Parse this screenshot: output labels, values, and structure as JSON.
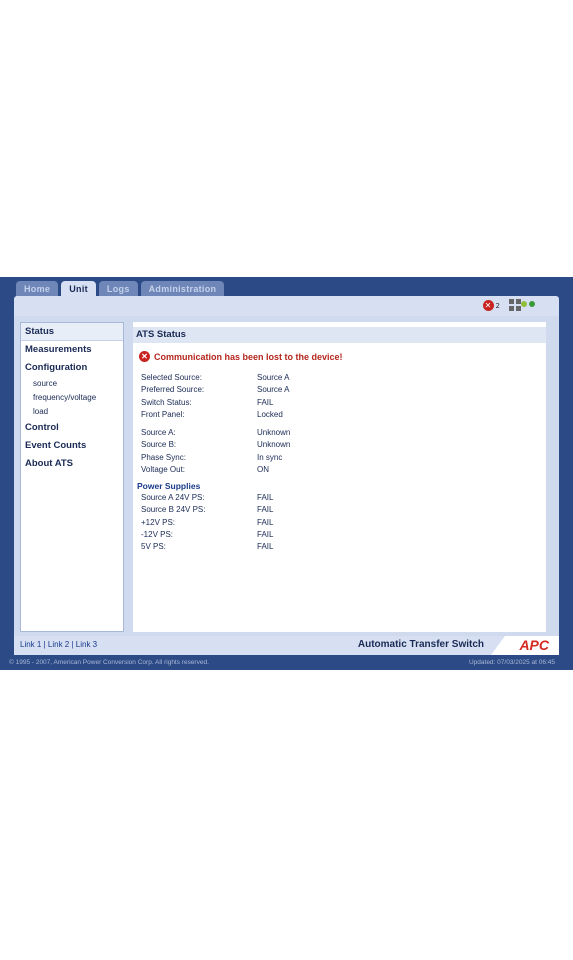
{
  "tabs": [
    "Home",
    "Unit",
    "Logs",
    "Administration"
  ],
  "active_tab": "Unit",
  "toolbar": {
    "alarm_count": "2"
  },
  "sidebar": {
    "items": [
      {
        "label": "Status",
        "type": "main",
        "active": true
      },
      {
        "label": "Measurements",
        "type": "main"
      },
      {
        "label": "Configuration",
        "type": "main"
      },
      {
        "label": "source",
        "type": "sub"
      },
      {
        "label": "frequency/voltage",
        "type": "sub"
      },
      {
        "label": "load",
        "type": "sub"
      },
      {
        "label": "Control",
        "type": "main"
      },
      {
        "label": "Event Counts",
        "type": "main"
      },
      {
        "label": "About ATS",
        "type": "main"
      }
    ]
  },
  "content": {
    "title": "ATS Status",
    "error": "Communication has been lost to the device!",
    "group1": [
      {
        "k": "Selected Source:",
        "v": "Source A"
      },
      {
        "k": "Preferred Source:",
        "v": "Source A"
      },
      {
        "k": "Switch Status:",
        "v": "FAIL"
      },
      {
        "k": "Front Panel:",
        "v": "Locked"
      }
    ],
    "group2": [
      {
        "k": "Source A:",
        "v": "Unknown"
      },
      {
        "k": "Source B:",
        "v": "Unknown"
      },
      {
        "k": "Phase Sync:",
        "v": "In sync"
      },
      {
        "k": "Voltage Out:",
        "v": "ON"
      }
    ],
    "power_supplies_heading": "Power Supplies",
    "group3": [
      {
        "k": "Source A 24V PS:",
        "v": "FAIL"
      },
      {
        "k": "Source B 24V PS:",
        "v": "FAIL"
      },
      {
        "k": "+12V PS:",
        "v": "FAIL"
      },
      {
        "k": "-12V PS:",
        "v": "FAIL"
      },
      {
        "k": "5V PS:",
        "v": "FAIL"
      }
    ]
  },
  "footer": {
    "links": [
      "Link 1",
      "Link 2",
      "Link 3"
    ],
    "product": "Automatic Transfer Switch",
    "logo": "APC",
    "copyright": "© 1995 - 2007, American Power Conversion Corp. All rights reserved.",
    "updated": "Updated: 07/03/2025 at 06:45"
  },
  "colors": {
    "frame": "#2c4a86",
    "error": "#c8231f",
    "led_1": "#8fbf3a",
    "led_2": "#3a9a3a"
  }
}
